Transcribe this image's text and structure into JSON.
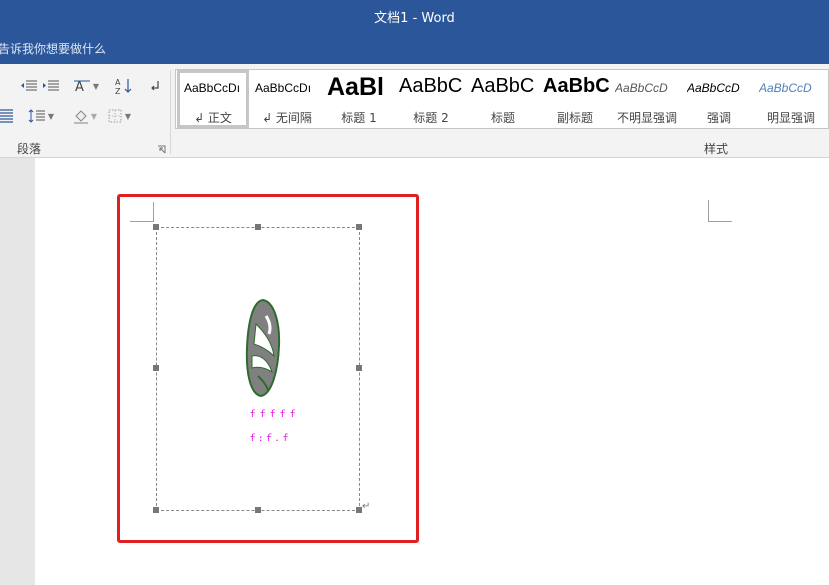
{
  "window": {
    "title": "文档1  -  Word"
  },
  "tell_me": {
    "text": "告诉我你想要做什么"
  },
  "paragraph_group": {
    "label": "段落"
  },
  "styles_group": {
    "label": "样式",
    "items": [
      {
        "preview": "AaBbCcDı",
        "name": "↲ 正文",
        "selected": true
      },
      {
        "preview": "AaBbCcDı",
        "name": "↲ 无间隔"
      },
      {
        "preview": "AaBl",
        "name": "标题 1"
      },
      {
        "preview": "AaBbC",
        "name": "标题 2"
      },
      {
        "preview": "AaBbC",
        "name": "标题"
      },
      {
        "preview": "AaBbC",
        "name": "副标题"
      },
      {
        "preview": "AaBbCcD",
        "name": "不明显强调"
      },
      {
        "preview": "AaBbCcD",
        "name": "强调"
      },
      {
        "preview": "AaBbCcD",
        "name": "明显强调"
      }
    ]
  },
  "document": {
    "caption_line1": "ｆｆｆｆｆ",
    "caption_line2": "ｆ:ｆ.ｆ",
    "paragraph_mark": "↵"
  },
  "colors": {
    "titlebar": "#2b579a",
    "highlight": "#e02020",
    "caption": "#e000e0",
    "logo_fill": "#808080",
    "logo_outline": "#2e6b2e"
  },
  "icons": {
    "decrease_indent": "decrease-indent-icon",
    "increase_indent": "increase-indent-icon",
    "chinese_layout": "chinese-layout-icon",
    "sort": "sort-icon",
    "show_marks": "paragraph-mark-icon",
    "distributed": "distributed-align-icon",
    "line_spacing": "line-spacing-icon",
    "shading": "shading-icon",
    "borders": "borders-icon"
  }
}
